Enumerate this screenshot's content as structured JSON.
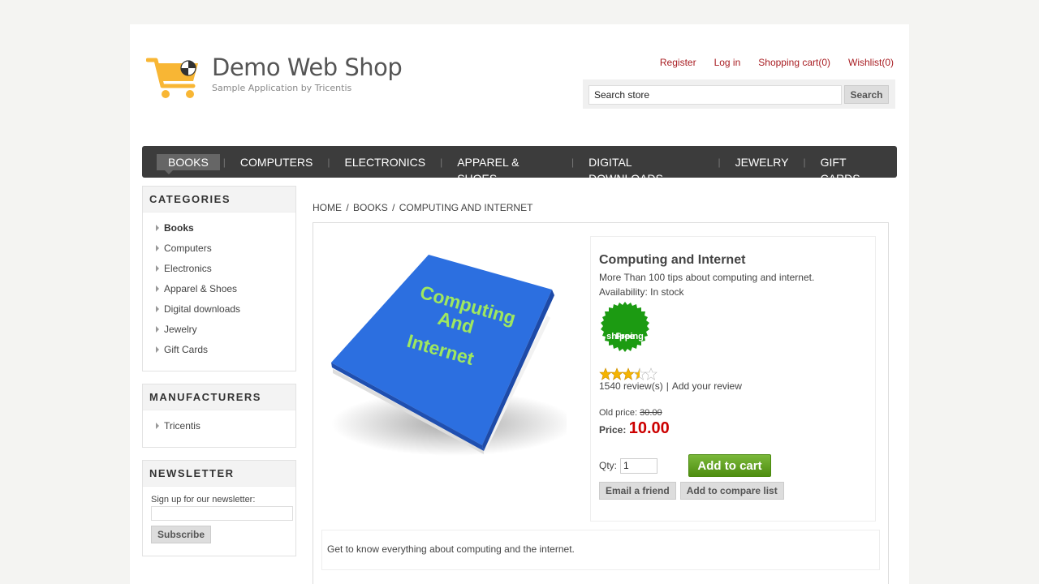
{
  "header": {
    "title": "Demo Web Shop",
    "subtitle": "Sample Application by Tricentis",
    "links": [
      "Register",
      "Log in",
      "Shopping cart(0)",
      "Wishlist(0)"
    ],
    "search_value": "Search store",
    "search_button": "Search"
  },
  "topmenu": {
    "items": [
      "BOOKS",
      "COMPUTERS",
      "ELECTRONICS",
      "APPAREL & SHOES",
      "DIGITAL DOWNLOADS",
      "JEWELRY",
      "GIFT CARDS"
    ],
    "active": "BOOKS"
  },
  "categories": {
    "title": "CATEGORIES",
    "items": [
      "Books",
      "Computers",
      "Electronics",
      "Apparel & Shoes",
      "Digital downloads",
      "Jewelry",
      "Gift Cards"
    ]
  },
  "manufacturers": {
    "title": "MANUFACTURERS",
    "items": [
      "Tricentis"
    ]
  },
  "newsletter": {
    "title": "NEWSLETTER",
    "label": "Sign up for our newsletter:",
    "email_value": "",
    "button": "Subscribe"
  },
  "breadcrumb": [
    "HOME",
    "BOOKS",
    "COMPUTING AND INTERNET"
  ],
  "product": {
    "image_text": [
      "Computing",
      "And",
      "Internet"
    ],
    "name": "Computing and Internet",
    "short_description": "More Than 100 tips about computing and internet.",
    "availability": "Availability: In stock",
    "free_shipping": [
      "Free",
      "shipping"
    ],
    "rating_stars": 3.5,
    "reviews": "1540 review(s)",
    "add_review": "Add your review",
    "old_price_label": "Old price:",
    "old_price": "30.00",
    "price_label": "Price:",
    "price": "10.00",
    "qty_label": "Qty:",
    "qty": "1",
    "add_to_cart": "Add to cart",
    "email_friend": "Email a friend",
    "compare": "Add to compare list",
    "full_description": "Get to know everything about computing and the internet."
  },
  "colors": {
    "link_red": "#a81d22",
    "price_red": "#cc0000",
    "menu_bg": "#3c3c3c",
    "cart_green": "#5e9e1e",
    "logo_orange": "#f8b634",
    "book_blue": "#2c6fe0",
    "book_text": "#9fe85f"
  }
}
